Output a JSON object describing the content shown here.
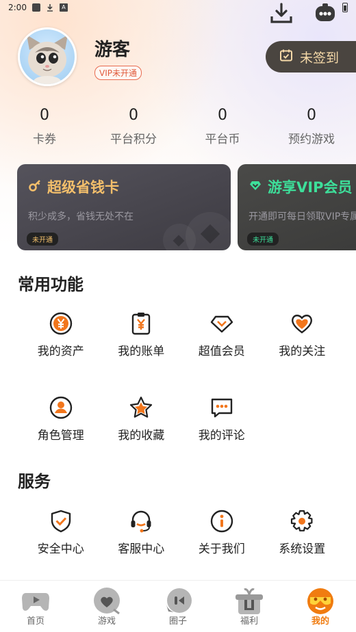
{
  "status_bar": {
    "time": "2:00"
  },
  "header": {
    "download_icon": "download-icon",
    "service_icon": "robot-chat-icon"
  },
  "profile": {
    "name": "游客",
    "vip_badge": "VIP未开通",
    "signin_label": "未签到"
  },
  "stats": [
    {
      "value": "0",
      "label": "卡券"
    },
    {
      "value": "0",
      "label": "平台积分"
    },
    {
      "value": "0",
      "label": "平台币"
    },
    {
      "value": "0",
      "label": "预约游戏"
    }
  ],
  "cards": [
    {
      "title": "超级省钱卡",
      "subtitle": "积少成多，省钱无处不在",
      "tag": "未开通",
      "accent": "#f3bf6b"
    },
    {
      "title": "游享VIP会员",
      "subtitle": "开通即可每日领取VIP专属礼包",
      "tag": "未开通",
      "accent": "#3ddf9a"
    }
  ],
  "common": {
    "title": "常用功能",
    "items": [
      {
        "label": "我的资产",
        "icon": "yen-coin-icon"
      },
      {
        "label": "我的账单",
        "icon": "bill-icon"
      },
      {
        "label": "超值会员",
        "icon": "diamond-icon"
      },
      {
        "label": "我的关注",
        "icon": "heart-icon"
      },
      {
        "label": "角色管理",
        "icon": "user-icon"
      },
      {
        "label": "我的收藏",
        "icon": "star-icon"
      },
      {
        "label": "我的评论",
        "icon": "comment-icon"
      }
    ]
  },
  "services": {
    "title": "服务",
    "items": [
      {
        "label": "安全中心",
        "icon": "shield-icon"
      },
      {
        "label": "客服中心",
        "icon": "headset-icon"
      },
      {
        "label": "关于我们",
        "icon": "info-icon"
      },
      {
        "label": "系统设置",
        "icon": "gear-icon"
      }
    ]
  },
  "tabbar": {
    "active": "我的",
    "tabs": [
      {
        "label": "首页",
        "icon": "gamepad-icon"
      },
      {
        "label": "游戏",
        "icon": "heart-bubble-icon"
      },
      {
        "label": "圈子",
        "icon": "chat-bubble-icon"
      },
      {
        "label": "福利",
        "icon": "gift-icon"
      },
      {
        "label": "我的",
        "icon": "profile-face-icon"
      }
    ]
  },
  "colors": {
    "accent": "#f07c10",
    "icon_orange": "#f2761c",
    "signin_bg": "#4a4540"
  }
}
